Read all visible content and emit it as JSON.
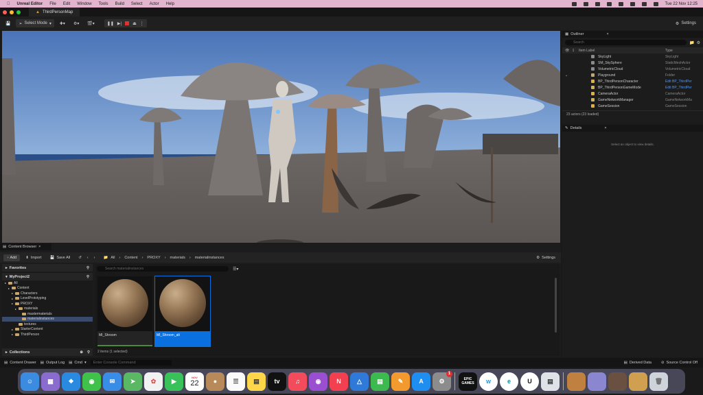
{
  "menubar": {
    "app": "Unreal Editor",
    "items": [
      "File",
      "Edit",
      "Window",
      "Tools",
      "Build",
      "Select",
      "Actor",
      "Help"
    ],
    "clock": "Tue 22 Nov  12:25"
  },
  "titlebar": {
    "tab": "ThirdPersonMap"
  },
  "toolbar": {
    "mode": "Select Mode",
    "settings": "Settings"
  },
  "outliner": {
    "title": "Outliner",
    "search_placeholder": "Search",
    "col_label": "Item Label",
    "col_type": "Type",
    "rows": [
      {
        "label": "SkyLight",
        "type": "SkyLight",
        "color": "#8a8a8a"
      },
      {
        "label": "SM_SkySphere",
        "type": "StaticMeshActor",
        "color": "#8a8a8a"
      },
      {
        "label": "VolumetricCloud",
        "type": "VolumetricCloud",
        "color": "#8a8a8a"
      },
      {
        "label": "Playground",
        "type": "Folder",
        "color": "#c8a56a"
      },
      {
        "label": "BP_ThirdPersonCharacter",
        "type": "Edit BP_ThirdPer",
        "color": "#d9b04a",
        "link": true
      },
      {
        "label": "BP_ThirdPersonGameMode",
        "type": "Edit BP_ThirdPer",
        "color": "#d9b04a",
        "link": true
      },
      {
        "label": "CameraActor",
        "type": "CameraActor",
        "color": "#d9b04a"
      },
      {
        "label": "GameNetworkManager",
        "type": "GameNetworkMa",
        "color": "#d9b04a"
      },
      {
        "label": "GameSession",
        "type": "GameSession",
        "color": "#d9b04a"
      }
    ],
    "count": "23 actors (23 loaded)"
  },
  "details": {
    "title": "Details",
    "empty": "Select an object to view details."
  },
  "content_browser": {
    "title": "Content Browser",
    "add": "Add",
    "import": "Import",
    "save_all": "Save All",
    "breadcrumb": [
      "All",
      "Content",
      "PROXY",
      "materials",
      "materialinstances"
    ],
    "settings": "Settings",
    "search_placeholder": "Search materialinstances",
    "favorites": "Favorites",
    "project": "MyProject2",
    "tree": [
      {
        "label": "All",
        "depth": 0
      },
      {
        "label": "Content",
        "depth": 1
      },
      {
        "label": "Characters",
        "depth": 2
      },
      {
        "label": "LevelPrototyping",
        "depth": 2
      },
      {
        "label": "PROXY",
        "depth": 2
      },
      {
        "label": "materials",
        "depth": 3
      },
      {
        "label": "mastermaterials",
        "depth": 4
      },
      {
        "label": "materialinstances",
        "depth": 4,
        "selected": true
      },
      {
        "label": "textures",
        "depth": 3
      },
      {
        "label": "StarterContent",
        "depth": 2
      },
      {
        "label": "ThirdPerson",
        "depth": 2
      }
    ],
    "collections": "Collections",
    "assets": [
      {
        "name": "MI_Shroom",
        "selected": false
      },
      {
        "name": "MI_Shroom_alt",
        "selected": true
      }
    ],
    "item_count": "2 items (1 selected)"
  },
  "statusbar": {
    "content_drawer": "Content Drawer",
    "output_log": "Output Log",
    "cmd": "Cmd",
    "console_placeholder": "Enter Console Command",
    "derived": "Derived Data",
    "source_control": "Source Control Off"
  },
  "dock": {
    "calendar_month": "NOV",
    "calendar_day": "22",
    "badge": "1",
    "epic": "EPIC GAMES"
  }
}
